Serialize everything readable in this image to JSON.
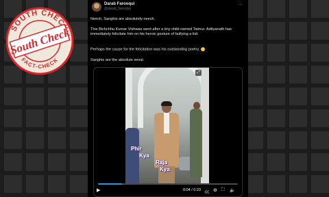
{
  "watermark": {
    "top_text": "SOUTH CHECK",
    "bottom_text": "FACT-CHECK",
    "logo_text": "South Check"
  },
  "tweet": {
    "name": "Darab Farooqui",
    "handle": "@darab_farooqui",
    "more_icon": "ellipsis-icon",
    "paragraphs": [
      "Neech, Sanghis are absolutely neech.",
      "This Bichchhu Kumar Vishwas went after a tiny child named Taimur. Adityanath has immediately felicitate him on his heroic gesture of bullying a kid.",
      "Perhaps the cause for the felicitation was his outstanding poetry.",
      "Sanghis are the absolute worst."
    ]
  },
  "video": {
    "captions": [
      "Phir",
      "Kya",
      "Raja",
      "Kya"
    ],
    "time": "0:04 / 0:23",
    "progress": 0.17,
    "icons": [
      "play-icon",
      "captions-icon",
      "settings-icon",
      "fullscreen-icon",
      "volume-icon",
      "expand-icon"
    ]
  },
  "colors": {
    "stamp_red": "#d9262b",
    "accent": "#1d9bf0"
  }
}
